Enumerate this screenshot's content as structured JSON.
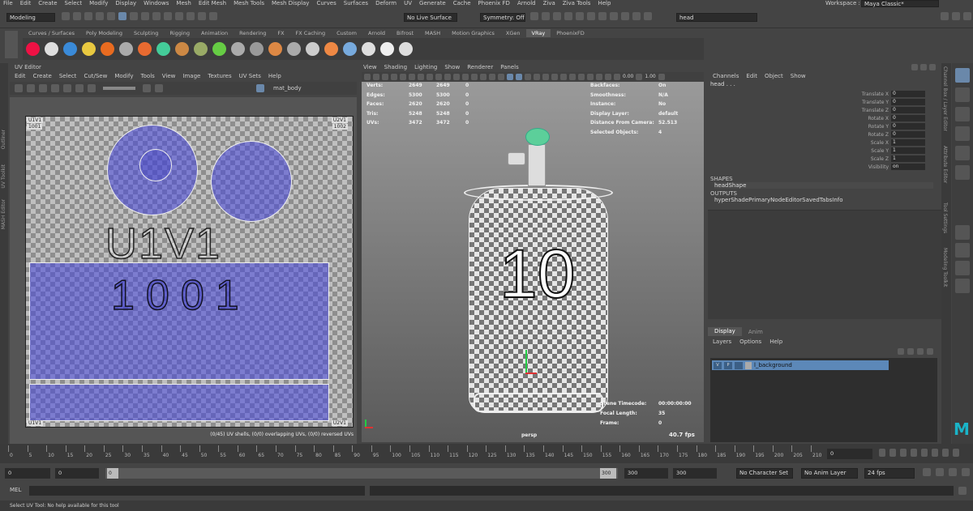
{
  "menubar": {
    "items": [
      "File",
      "Edit",
      "Create",
      "Select",
      "Modify",
      "Display",
      "Windows",
      "Mesh",
      "Edit Mesh",
      "Mesh Tools",
      "Mesh Display",
      "Curves",
      "Surfaces",
      "Deform",
      "UV",
      "Generate",
      "Cache",
      "Phoenix FD",
      "Arnold",
      "Ziva",
      "Ziva Tools",
      "Help"
    ],
    "workspace_label": "Workspace :",
    "workspace_value": "Maya Classic*"
  },
  "status": {
    "mode": "Modeling",
    "live_surface": "No Live Surface",
    "symmetry": "Symmetry: Off",
    "search_value": "head"
  },
  "shelf": {
    "tabs": [
      "Curves / Surfaces",
      "Poly Modeling",
      "Sculpting",
      "Rigging",
      "Animation",
      "Rendering",
      "FX",
      "FX Caching",
      "Custom",
      "Arnold",
      "Bifrost",
      "MASH",
      "Motion Graphics",
      "XGen",
      "VRay",
      "PhoenixFD"
    ],
    "active_tab": "VRay"
  },
  "side_labels": {
    "outliner": "Outliner",
    "uv_toolkit": "UV Toolkit",
    "mash_editor": "MASH Editor",
    "channel_box": "Channel Box / Layer Editor",
    "attribute_editor": "Attribute Editor",
    "tool_settings": "Tool Settings",
    "modeling_toolkit": "Modeling Toolkit"
  },
  "uv_editor": {
    "title": "UV Editor",
    "menus": [
      "Edit",
      "Create",
      "Select",
      "Cut/Sew",
      "Modify",
      "Tools",
      "View",
      "Image",
      "Textures",
      "UV Sets",
      "Help"
    ],
    "material": "mat_body",
    "tile_u1v1": "U1V1",
    "tile_1001": "1001",
    "tile_u2v1": "U2V1",
    "tile_1002": "1002",
    "tile_u1v1_bottom": "U1V1",
    "tile_u2v1_bottom": "U2V1",
    "big_label_u1v1": "U1V1",
    "big_label_1001": "1001",
    "status": "(0/45) UV shells, (0/0) overlapping UVs, (0/0) reversed UVs"
  },
  "viewport": {
    "menus": [
      "View",
      "Shading",
      "Lighting",
      "Show",
      "Renderer",
      "Panels"
    ],
    "toolbar_value_a": "0.00",
    "toolbar_value_b": "1.00",
    "stats": [
      {
        "label": "Verts:",
        "a": "2649",
        "b": "2649",
        "c": "0"
      },
      {
        "label": "Edges:",
        "a": "5300",
        "b": "5300",
        "c": "0"
      },
      {
        "label": "Faces:",
        "a": "2620",
        "b": "2620",
        "c": "0"
      },
      {
        "label": "Tris:",
        "a": "5248",
        "b": "5248",
        "c": "0"
      },
      {
        "label": "UVs:",
        "a": "3472",
        "b": "3472",
        "c": "0"
      }
    ],
    "info": [
      {
        "label": "Backfaces:",
        "value": "On"
      },
      {
        "label": "Smoothness:",
        "value": "N/A"
      },
      {
        "label": "Instance:",
        "value": "No"
      },
      {
        "label": "Display Layer:",
        "value": "default"
      },
      {
        "label": "Distance From Camera:",
        "value": "52.513"
      },
      {
        "label": "Selected Objects:",
        "value": "4"
      }
    ],
    "model_label": "10",
    "camera_info": [
      {
        "label": "Scene Timecode:",
        "value": "00:00:00:00"
      },
      {
        "label": "Focal Length:",
        "value": "35"
      },
      {
        "label": "Frame:",
        "value": "0"
      }
    ],
    "camera_name": "persp",
    "fps": "40.7 fps"
  },
  "channel_box": {
    "menus": [
      "Channels",
      "Edit",
      "Object",
      "Show"
    ],
    "object": "head . . .",
    "channels": [
      {
        "label": "Translate X",
        "value": "0"
      },
      {
        "label": "Translate Y",
        "value": "0"
      },
      {
        "label": "Translate Z",
        "value": "0"
      },
      {
        "label": "Rotate X",
        "value": "0"
      },
      {
        "label": "Rotate Y",
        "value": "0"
      },
      {
        "label": "Rotate Z",
        "value": "0"
      },
      {
        "label": "Scale X",
        "value": "1"
      },
      {
        "label": "Scale Y",
        "value": "1"
      },
      {
        "label": "Scale Z",
        "value": "1"
      },
      {
        "label": "Visibility",
        "value": "on"
      }
    ],
    "shapes_header": "SHAPES",
    "shape_name": "headShape",
    "outputs_header": "OUTPUTS",
    "output_name": "hyperShadePrimaryNodeEditorSavedTabsInfo"
  },
  "layer_editor": {
    "tabs": [
      "Display",
      "Anim"
    ],
    "menus": [
      "Layers",
      "Options",
      "Help"
    ],
    "layer_name": "l_background",
    "layer_v": "V",
    "layer_p": "P"
  },
  "timeline": {
    "ticks": [
      "0",
      "5",
      "10",
      "15",
      "20",
      "25",
      "30",
      "35",
      "40",
      "45",
      "50",
      "55",
      "60",
      "65",
      "70",
      "75",
      "80",
      "85",
      "90",
      "95",
      "100",
      "105",
      "110",
      "115",
      "120",
      "125",
      "130",
      "135",
      "140",
      "145",
      "150",
      "155",
      "160",
      "165",
      "170",
      "175",
      "180",
      "185",
      "190",
      "195",
      "200",
      "205",
      "210"
    ],
    "current_frame": "0"
  },
  "range": {
    "start": "0",
    "playback_start": "0",
    "slider_start": "0",
    "slider_end": "300",
    "playback_end": "300",
    "end": "300",
    "character_set": "No Character Set",
    "anim_layer": "No Anim Layer",
    "fps": "24 fps"
  },
  "command": {
    "label": "MEL"
  },
  "help_line": "Select UV Tool: No help available for this tool"
}
